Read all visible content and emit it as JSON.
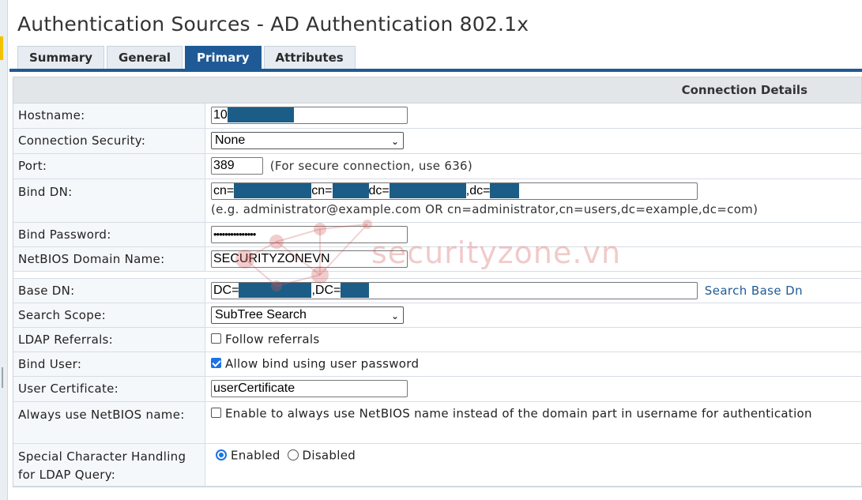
{
  "page": {
    "title": "Authentication Sources - AD Authentication 802.1x"
  },
  "tabs": [
    {
      "label": "Summary",
      "active": false
    },
    {
      "label": "General",
      "active": false
    },
    {
      "label": "Primary",
      "active": true
    },
    {
      "label": "Attributes",
      "active": false
    }
  ],
  "section": {
    "header": "Connection Details"
  },
  "fields": {
    "hostname": {
      "label": "Hostname:",
      "value": "10"
    },
    "connection_security": {
      "label": "Connection Security:",
      "selected": "None"
    },
    "port": {
      "label": "Port:",
      "value": "389",
      "hint": "(For secure connection, use 636)"
    },
    "bind_dn": {
      "label": "Bind DN:",
      "parts": [
        "cn=",
        "cn=",
        "dc=",
        ",dc="
      ],
      "hint": "(e.g. administrator@example.com OR cn=administrator,cn=users,dc=example,dc=com)"
    },
    "bind_password": {
      "label": "Bind Password:",
      "value": "•••••••••••••••"
    },
    "netbios_domain": {
      "label": "NetBIOS Domain Name:",
      "value": "SECURITYZONEVN"
    },
    "base_dn": {
      "label": "Base DN:",
      "parts": [
        "DC=",
        ",DC="
      ],
      "link": "Search Base Dn"
    },
    "search_scope": {
      "label": "Search Scope:",
      "selected": "SubTree Search"
    },
    "ldap_referrals": {
      "label": "LDAP Referrals:",
      "option": "Follow referrals",
      "checked": false
    },
    "bind_user": {
      "label": "Bind User:",
      "option": "Allow bind using user password",
      "checked": true
    },
    "user_certificate": {
      "label": "User Certificate:",
      "value": "userCertificate"
    },
    "always_netbios": {
      "label": "Always use NetBIOS name:",
      "option": "Enable to always use NetBIOS name instead of the domain part in username for authentication",
      "checked": false
    },
    "special_char": {
      "label": "Special Character Handling for LDAP Query:",
      "options": [
        "Enabled",
        "Disabled"
      ],
      "selected": "Enabled"
    }
  },
  "watermark": {
    "text": "securityzone.vn"
  },
  "colors": {
    "accent": "#1f5a96",
    "mask": "#1b5d86",
    "checkbox": "#1a73e8"
  }
}
